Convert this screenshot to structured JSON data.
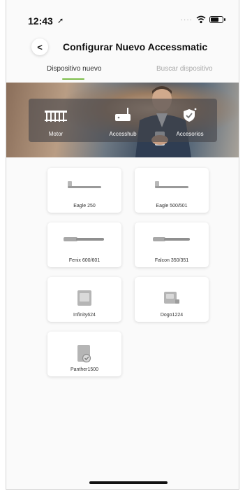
{
  "status_bar": {
    "time": "12:43",
    "location_icon": "location-arrow-icon",
    "signal_icon": "signal-dots-icon",
    "wifi_icon": "wifi-icon",
    "battery_icon": "battery-icon"
  },
  "header": {
    "back_icon": "chevron-left-icon",
    "back_glyph": "<",
    "title": "Configurar Nuevo Accessmatic"
  },
  "tabs": [
    {
      "label": "Dispositivo nuevo",
      "active": true
    },
    {
      "label": "Buscar dispositivo",
      "active": false
    }
  ],
  "categories": [
    {
      "label": "Motor",
      "icon": "gate-motor-icon"
    },
    {
      "label": "Accesshub",
      "icon": "hub-device-icon"
    },
    {
      "label": "Accesorios",
      "icon": "shield-accessory-icon"
    }
  ],
  "devices": [
    {
      "label": "Eagle 250",
      "icon": "swing-arm-motor-icon"
    },
    {
      "label": "Eagle 500/501",
      "icon": "swing-arm-motor-icon"
    },
    {
      "label": "Fenix 600/601",
      "icon": "linear-actuator-icon"
    },
    {
      "label": "Falcon 350/351",
      "icon": "linear-actuator-icon"
    },
    {
      "label": "Infinity624",
      "icon": "sliding-gate-motor-icon"
    },
    {
      "label": "Dogo1224",
      "icon": "sliding-gate-motor-icon"
    },
    {
      "label": "Panther1500",
      "icon": "heavy-sliding-motor-icon"
    }
  ],
  "colors": {
    "accent": "#7dbd4a",
    "text": "#111111",
    "muted": "#aaaaaa"
  }
}
